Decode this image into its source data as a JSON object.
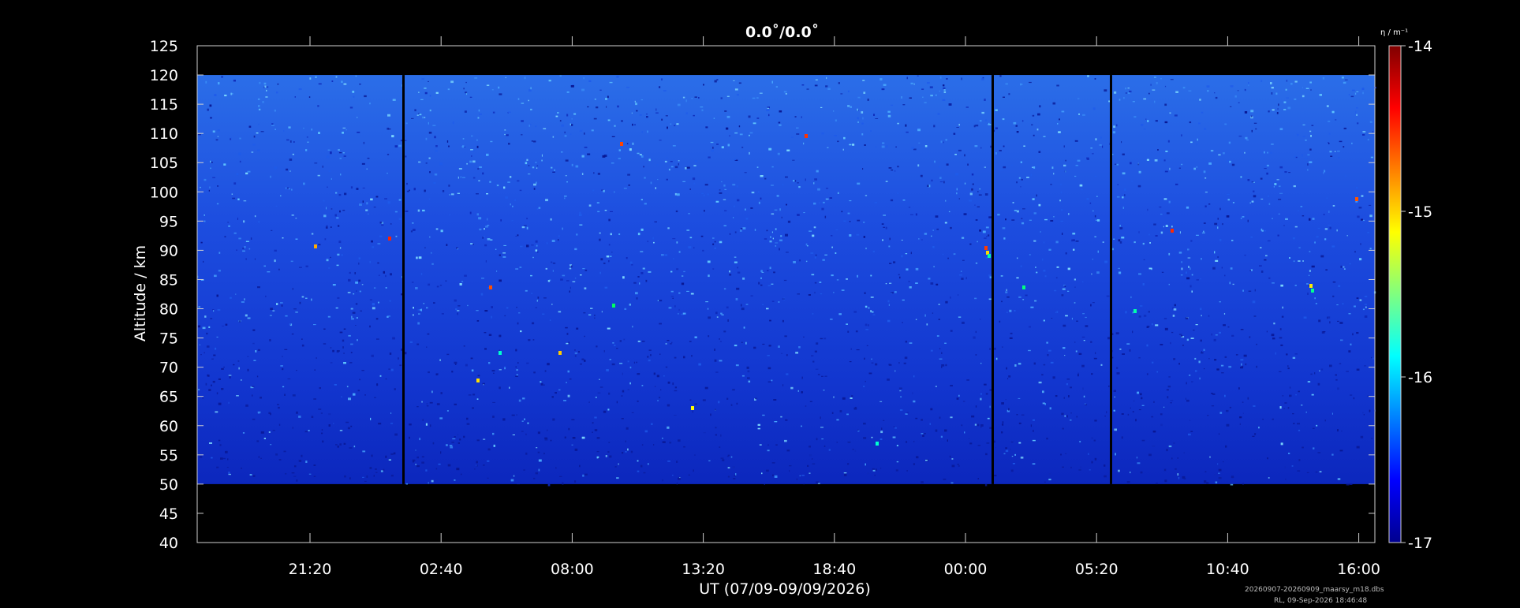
{
  "chart_data": {
    "type": "heatmap",
    "title": "0.0˚/0.0˚",
    "xlabel": "UT (07/09-09/09/2026)",
    "ylabel": "Altitude / km",
    "x_tick_labels": [
      "21:20",
      "02:40",
      "08:00",
      "13:20",
      "18:40",
      "00:00",
      "05:20",
      "10:40",
      "16:00"
    ],
    "y_ticks": [
      40,
      45,
      50,
      55,
      60,
      65,
      70,
      75,
      80,
      85,
      90,
      95,
      100,
      105,
      110,
      115,
      120,
      125
    ],
    "ylim": [
      40,
      125
    ],
    "data_altitude_range": [
      50,
      120
    ],
    "data_gaps_at": [
      "~00:40",
      "~00:40 (day 2)",
      "~05:40"
    ],
    "colorbar": {
      "label": "η / m⁻¹",
      "ticks": [
        -17,
        -16,
        -15,
        -14
      ],
      "range": [
        -17,
        -14
      ],
      "colormap": "jet"
    },
    "background_color": "#000000",
    "dominant_color": "#1436d4"
  },
  "footer": {
    "line1": "20260907-20260909_maarsy_m18.dbs",
    "line2": "RL, 09-Sep-2026 18:46:48"
  }
}
